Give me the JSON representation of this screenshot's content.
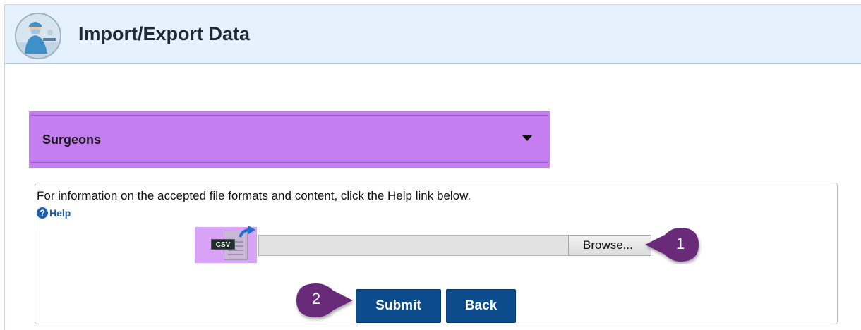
{
  "header": {
    "title": "Import/Export Data",
    "logo_icon": "surgeon-avatar-icon"
  },
  "selector": {
    "selected": "Surgeons",
    "caret_icon": "caret-down-icon",
    "highlight_color": "#c57ef0"
  },
  "panel": {
    "info_text": "For information on the accepted file formats and content, click the Help link below.",
    "help_label": "Help",
    "help_icon": "question-circle-icon",
    "csv_icon": "csv-file-icon",
    "csv_tag": "CSV",
    "browse_label": "Browse...",
    "file_value": ""
  },
  "callouts": {
    "one": "1",
    "two": "2",
    "color": "#6b2a7a"
  },
  "actions": {
    "submit_label": "Submit",
    "back_label": "Back",
    "button_color": "#0d4c8c"
  }
}
